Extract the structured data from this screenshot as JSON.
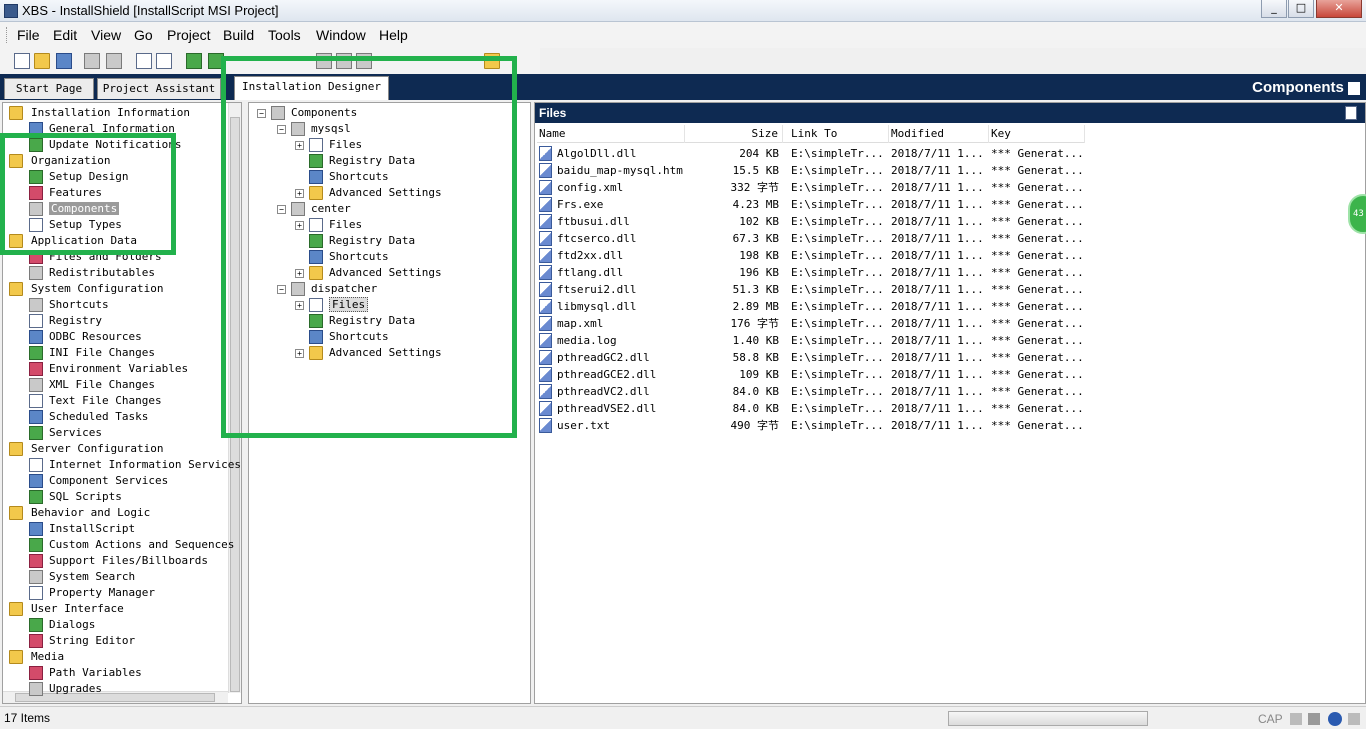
{
  "window": {
    "title": "XBS - InstallShield [InstallScript MSI Project]",
    "min": "_",
    "max": "□",
    "close": "✕"
  },
  "menu": [
    "File",
    "Edit",
    "View",
    "Go",
    "Project",
    "Build",
    "Tools",
    "Window",
    "Help"
  ],
  "tabs": {
    "start": "Start Page",
    "assistant": "Project Assistant",
    "designer": "Installation Designer"
  },
  "view_title": "Components",
  "nav": {
    "groups": [
      {
        "label": "Installation Information",
        "items": [
          "General Information",
          "Update Notifications"
        ]
      },
      {
        "label": "Organization",
        "items": [
          "Setup Design",
          "Features",
          "Components",
          "Setup Types"
        ]
      },
      {
        "label": "Application Data",
        "items": [
          "Files and Folders",
          "Redistributables"
        ]
      },
      {
        "label": "System Configuration",
        "items": [
          "Shortcuts",
          "Registry",
          "ODBC Resources",
          "INI File Changes",
          "Environment Variables",
          "XML File Changes",
          "Text File Changes",
          "Scheduled Tasks",
          "Services"
        ]
      },
      {
        "label": "Server Configuration",
        "items": [
          "Internet Information Services",
          "Component Services",
          "SQL Scripts"
        ]
      },
      {
        "label": "Behavior and Logic",
        "items": [
          "InstallScript",
          "Custom Actions and Sequences",
          "Support Files/Billboards",
          "System Search",
          "Property Manager"
        ]
      },
      {
        "label": "User Interface",
        "items": [
          "Dialogs",
          "String Editor"
        ]
      },
      {
        "label": "Media",
        "items": [
          "Path Variables",
          "Upgrades"
        ]
      }
    ]
  },
  "components_tree": {
    "root": "Components",
    "components": [
      {
        "name": "mysqsl",
        "children": [
          "Files",
          "Registry Data",
          "Shortcuts",
          "Advanced Settings"
        ]
      },
      {
        "name": "center",
        "children": [
          "Files",
          "Registry Data",
          "Shortcuts",
          "Advanced Settings"
        ]
      },
      {
        "name": "dispatcher",
        "children": [
          "Files",
          "Registry Data",
          "Shortcuts",
          "Advanced Settings"
        ]
      }
    ]
  },
  "files_panel": {
    "title": "Files",
    "columns": [
      "Name",
      "Size",
      "Link To",
      "Modified",
      "Key"
    ],
    "rows": [
      [
        "AlgolDll.dll",
        "204 KB",
        "E:\\simpleTr...",
        "2018/7/11 1...",
        "*** Generat..."
      ],
      [
        "baidu_map-mysql.htm",
        "15.5 KB",
        "E:\\simpleTr...",
        "2018/7/11 1...",
        "*** Generat..."
      ],
      [
        "config.xml",
        "332 字节",
        "E:\\simpleTr...",
        "2018/7/11 1...",
        "*** Generat..."
      ],
      [
        "Frs.exe",
        "4.23 MB",
        "E:\\simpleTr...",
        "2018/7/11 1...",
        "*** Generat..."
      ],
      [
        "ftbusui.dll",
        "102 KB",
        "E:\\simpleTr...",
        "2018/7/11 1...",
        "*** Generat..."
      ],
      [
        "ftcserco.dll",
        "67.3 KB",
        "E:\\simpleTr...",
        "2018/7/11 1...",
        "*** Generat..."
      ],
      [
        "ftd2xx.dll",
        "198 KB",
        "E:\\simpleTr...",
        "2018/7/11 1...",
        "*** Generat..."
      ],
      [
        "ftlang.dll",
        "196 KB",
        "E:\\simpleTr...",
        "2018/7/11 1...",
        "*** Generat..."
      ],
      [
        "ftserui2.dll",
        "51.3 KB",
        "E:\\simpleTr...",
        "2018/7/11 1...",
        "*** Generat..."
      ],
      [
        "libmysql.dll",
        "2.89 MB",
        "E:\\simpleTr...",
        "2018/7/11 1...",
        "*** Generat..."
      ],
      [
        "map.xml",
        "176 字节",
        "E:\\simpleTr...",
        "2018/7/11 1...",
        "*** Generat..."
      ],
      [
        "media.log",
        "1.40 KB",
        "E:\\simpleTr...",
        "2018/7/11 1...",
        "*** Generat..."
      ],
      [
        "pthreadGC2.dll",
        "58.8 KB",
        "E:\\simpleTr...",
        "2018/7/11 1...",
        "*** Generat..."
      ],
      [
        "pthreadGCE2.dll",
        "109 KB",
        "E:\\simpleTr...",
        "2018/7/11 1...",
        "*** Generat..."
      ],
      [
        "pthreadVC2.dll",
        "84.0 KB",
        "E:\\simpleTr...",
        "2018/7/11 1...",
        "*** Generat..."
      ],
      [
        "pthreadVSE2.dll",
        "84.0 KB",
        "E:\\simpleTr...",
        "2018/7/11 1...",
        "*** Generat..."
      ],
      [
        "user.txt",
        "490 字节",
        "E:\\simpleTr...",
        "2018/7/11 1...",
        "*** Generat..."
      ]
    ]
  },
  "status": {
    "items": "17 Items",
    "caps": "CAP",
    "badge": "43"
  },
  "colors": {
    "highlight": "#22b14c",
    "header": "#0e2a52"
  }
}
